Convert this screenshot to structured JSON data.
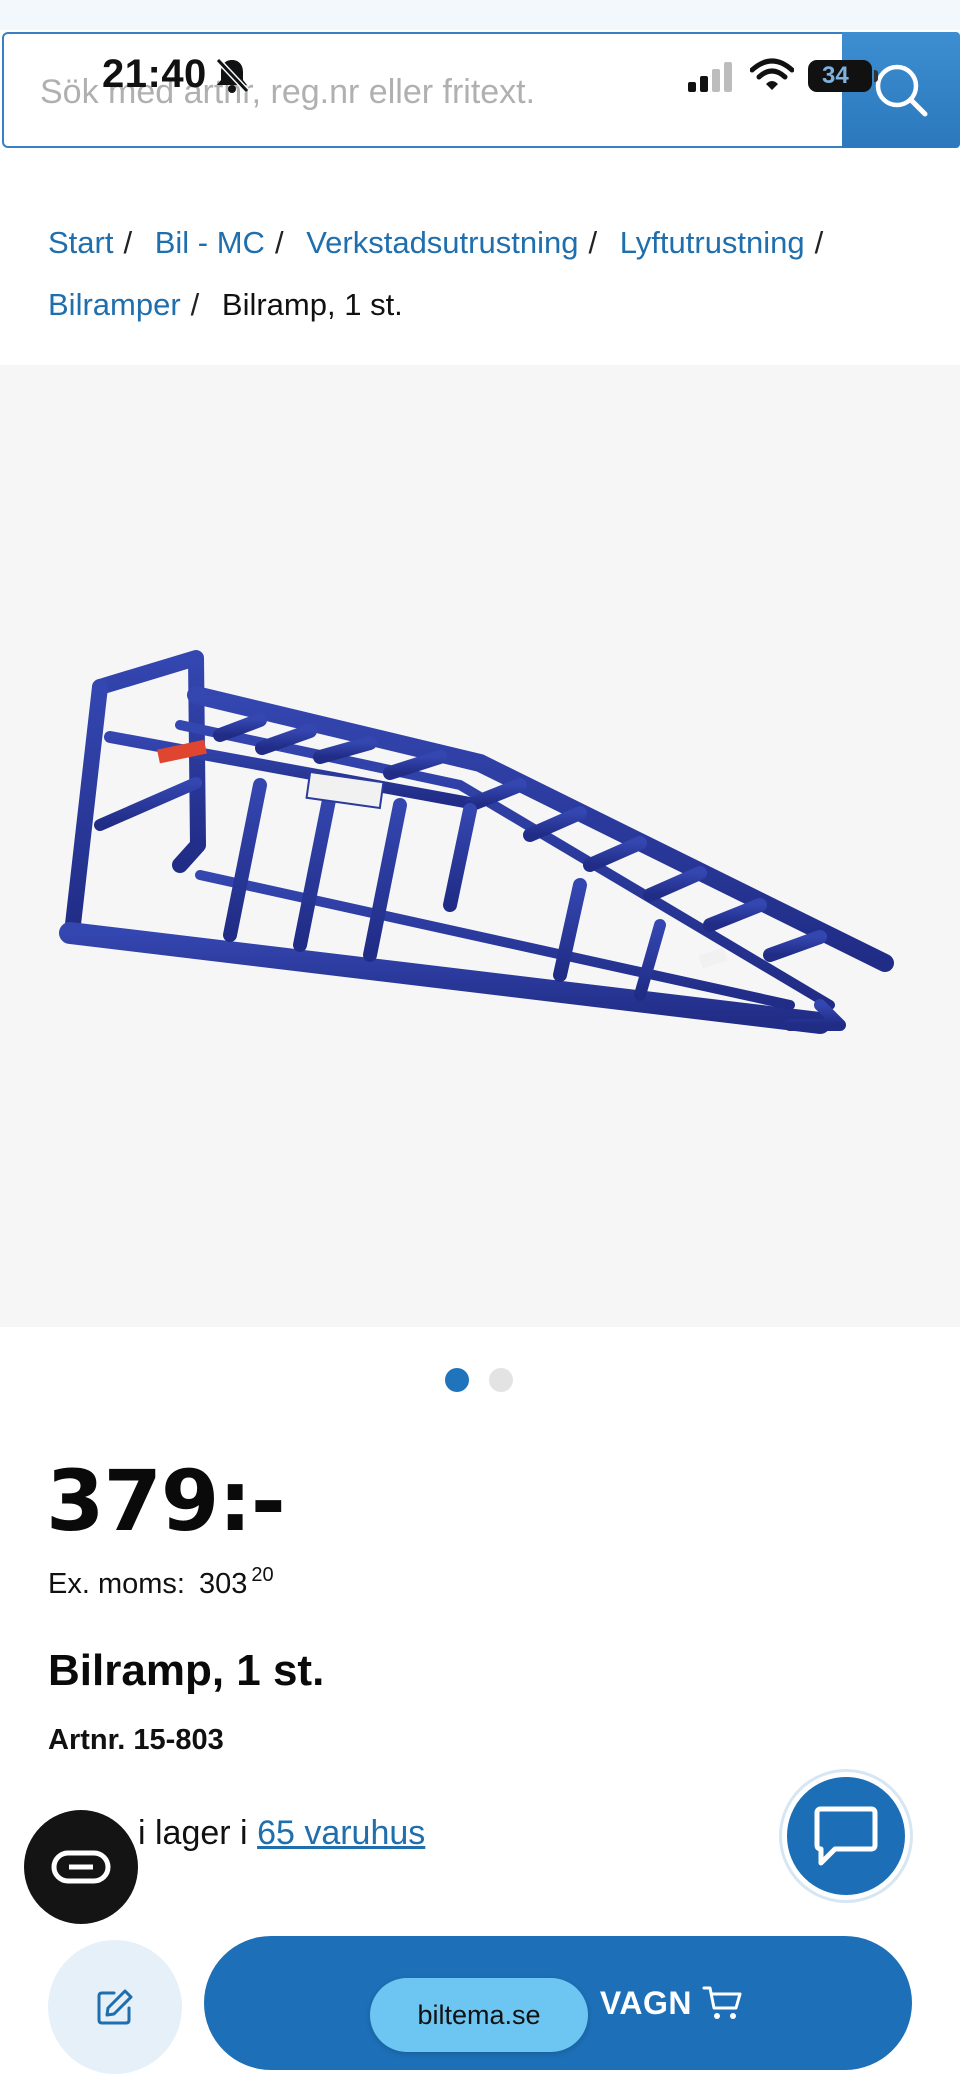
{
  "status_bar": {
    "time": "21:40",
    "battery": "34"
  },
  "search": {
    "placeholder": "Sök med artnr, reg.nr eller fritext."
  },
  "breadcrumb": {
    "items": [
      "Start",
      "Bil - MC",
      "Verkstadsutrustning",
      "Lyftutrustning",
      "Bilramper"
    ],
    "current": "Bilramp, 1 st."
  },
  "gallery": {
    "image_count": 2,
    "active_index": 0
  },
  "product": {
    "price": "379:-",
    "ex_moms_label": "Ex. moms:",
    "ex_moms_value": "303",
    "ex_moms_cents": "20",
    "title": "Bilramp, 1 st.",
    "artnr": "Artnr. 15-803",
    "stock_text": "i lager i",
    "stock_link": "65 varuhus"
  },
  "actions": {
    "cart_label": "VAGN"
  },
  "browser": {
    "url": "biltema.se"
  },
  "colors": {
    "brand_blue": "#1d6fb7",
    "link_blue": "#1f6ead",
    "ramp_blue": "#2a3a9c"
  },
  "icons": [
    "bell-slash-icon",
    "signal-icon",
    "wifi-icon",
    "search-icon",
    "reader-mode-icon",
    "chat-icon",
    "edit-icon",
    "cart-icon"
  ]
}
